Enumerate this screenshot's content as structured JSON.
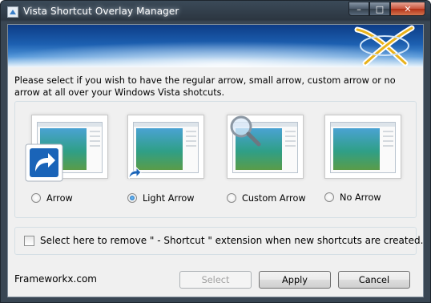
{
  "window": {
    "title": "Vista Shortcut Overlay Manager",
    "buttons": {
      "minimize": "–",
      "maximize": "□",
      "close": "✕"
    }
  },
  "prompt": "Please select if you wish to have the regular arrow, small arrow, custom arrow or no arrow at all over your Windows Vista shotcuts.",
  "options": [
    {
      "label": "Arrow",
      "icon": "large-shortcut-arrow-icon",
      "selected": false
    },
    {
      "label": "Light Arrow",
      "icon": "small-shortcut-arrow-icon",
      "selected": true
    },
    {
      "label": "Custom Arrow",
      "icon": "magnifier-icon",
      "selected": false
    },
    {
      "label": "No Arrow",
      "icon": "none",
      "selected": false
    }
  ],
  "remove_extension": {
    "label": "Select here to remove \" - Shortcut \" extension when new shortcuts are created.",
    "checked": false
  },
  "footer": {
    "brand": "Frameworkx.com",
    "select_label": "Select",
    "apply_label": "Apply",
    "cancel_label": "Cancel"
  },
  "colors": {
    "accent": "#1d5fa8",
    "banner": "#1c5fb0",
    "logo_gold": "#e9b21c"
  }
}
